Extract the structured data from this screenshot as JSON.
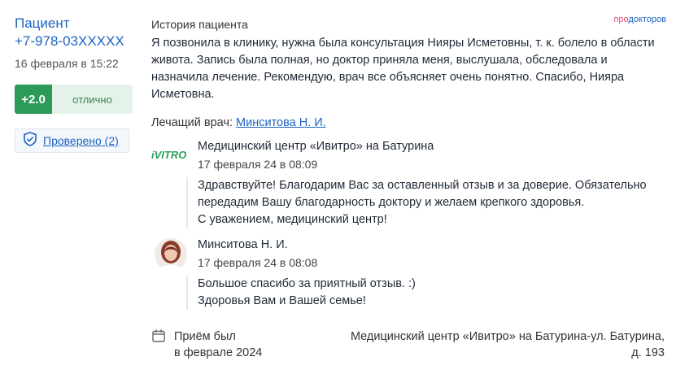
{
  "patient": {
    "name": "Пациент",
    "phone": "+7-978-03XXXXX",
    "date": "16 февраля в 15:22"
  },
  "rating": {
    "score": "+2.0",
    "label": "отлично",
    "color": "#2c9b59"
  },
  "verified": {
    "label": "Проверено (2)",
    "icon": "shield-check-icon"
  },
  "brand": {
    "part1": "про",
    "part2": "докторов"
  },
  "story": {
    "title": "История пациента",
    "text": "Я позвонила в клинику, нужна была консультация Нияры Исметовны, т. к. болело в области живота. Запись была полная, но доктор приняла меня, выслушала, обследовала и назначила лечение. Рекомендую, врач все объясняет очень понятно. Спасибо, Нияра Исметовна.",
    "doctor_prefix": "Лечащий врач:",
    "doctor_name": "Минситова Н. И."
  },
  "replies": [
    {
      "author": "Медицинский центр «Ивитро» на Батурина",
      "logo_text": "iVITRO",
      "date": "17 февраля 24 в 08:09",
      "lines": [
        "Здравствуйте! Благодарим Вас за оставленный отзыв и за доверие. Обязательно",
        "передадим Вашу благодарность доктору и желаем крепкого здоровья.",
        "С уважением, медицинский центр!"
      ]
    },
    {
      "author": "Минситова Н. И.",
      "date": "17 февраля 24 в 08:08",
      "lines": [
        "Большое спасибо за приятный отзыв. :)",
        "Здоровья Вам и Вашей семье!"
      ]
    }
  ],
  "footer": {
    "visit_line1": "Приём был",
    "visit_line2": "в феврале 2024",
    "clinic_line1": "Медицинский центр «Ивитро» на Батурина-ул. Батурина,",
    "clinic_line2": "д. 193"
  }
}
